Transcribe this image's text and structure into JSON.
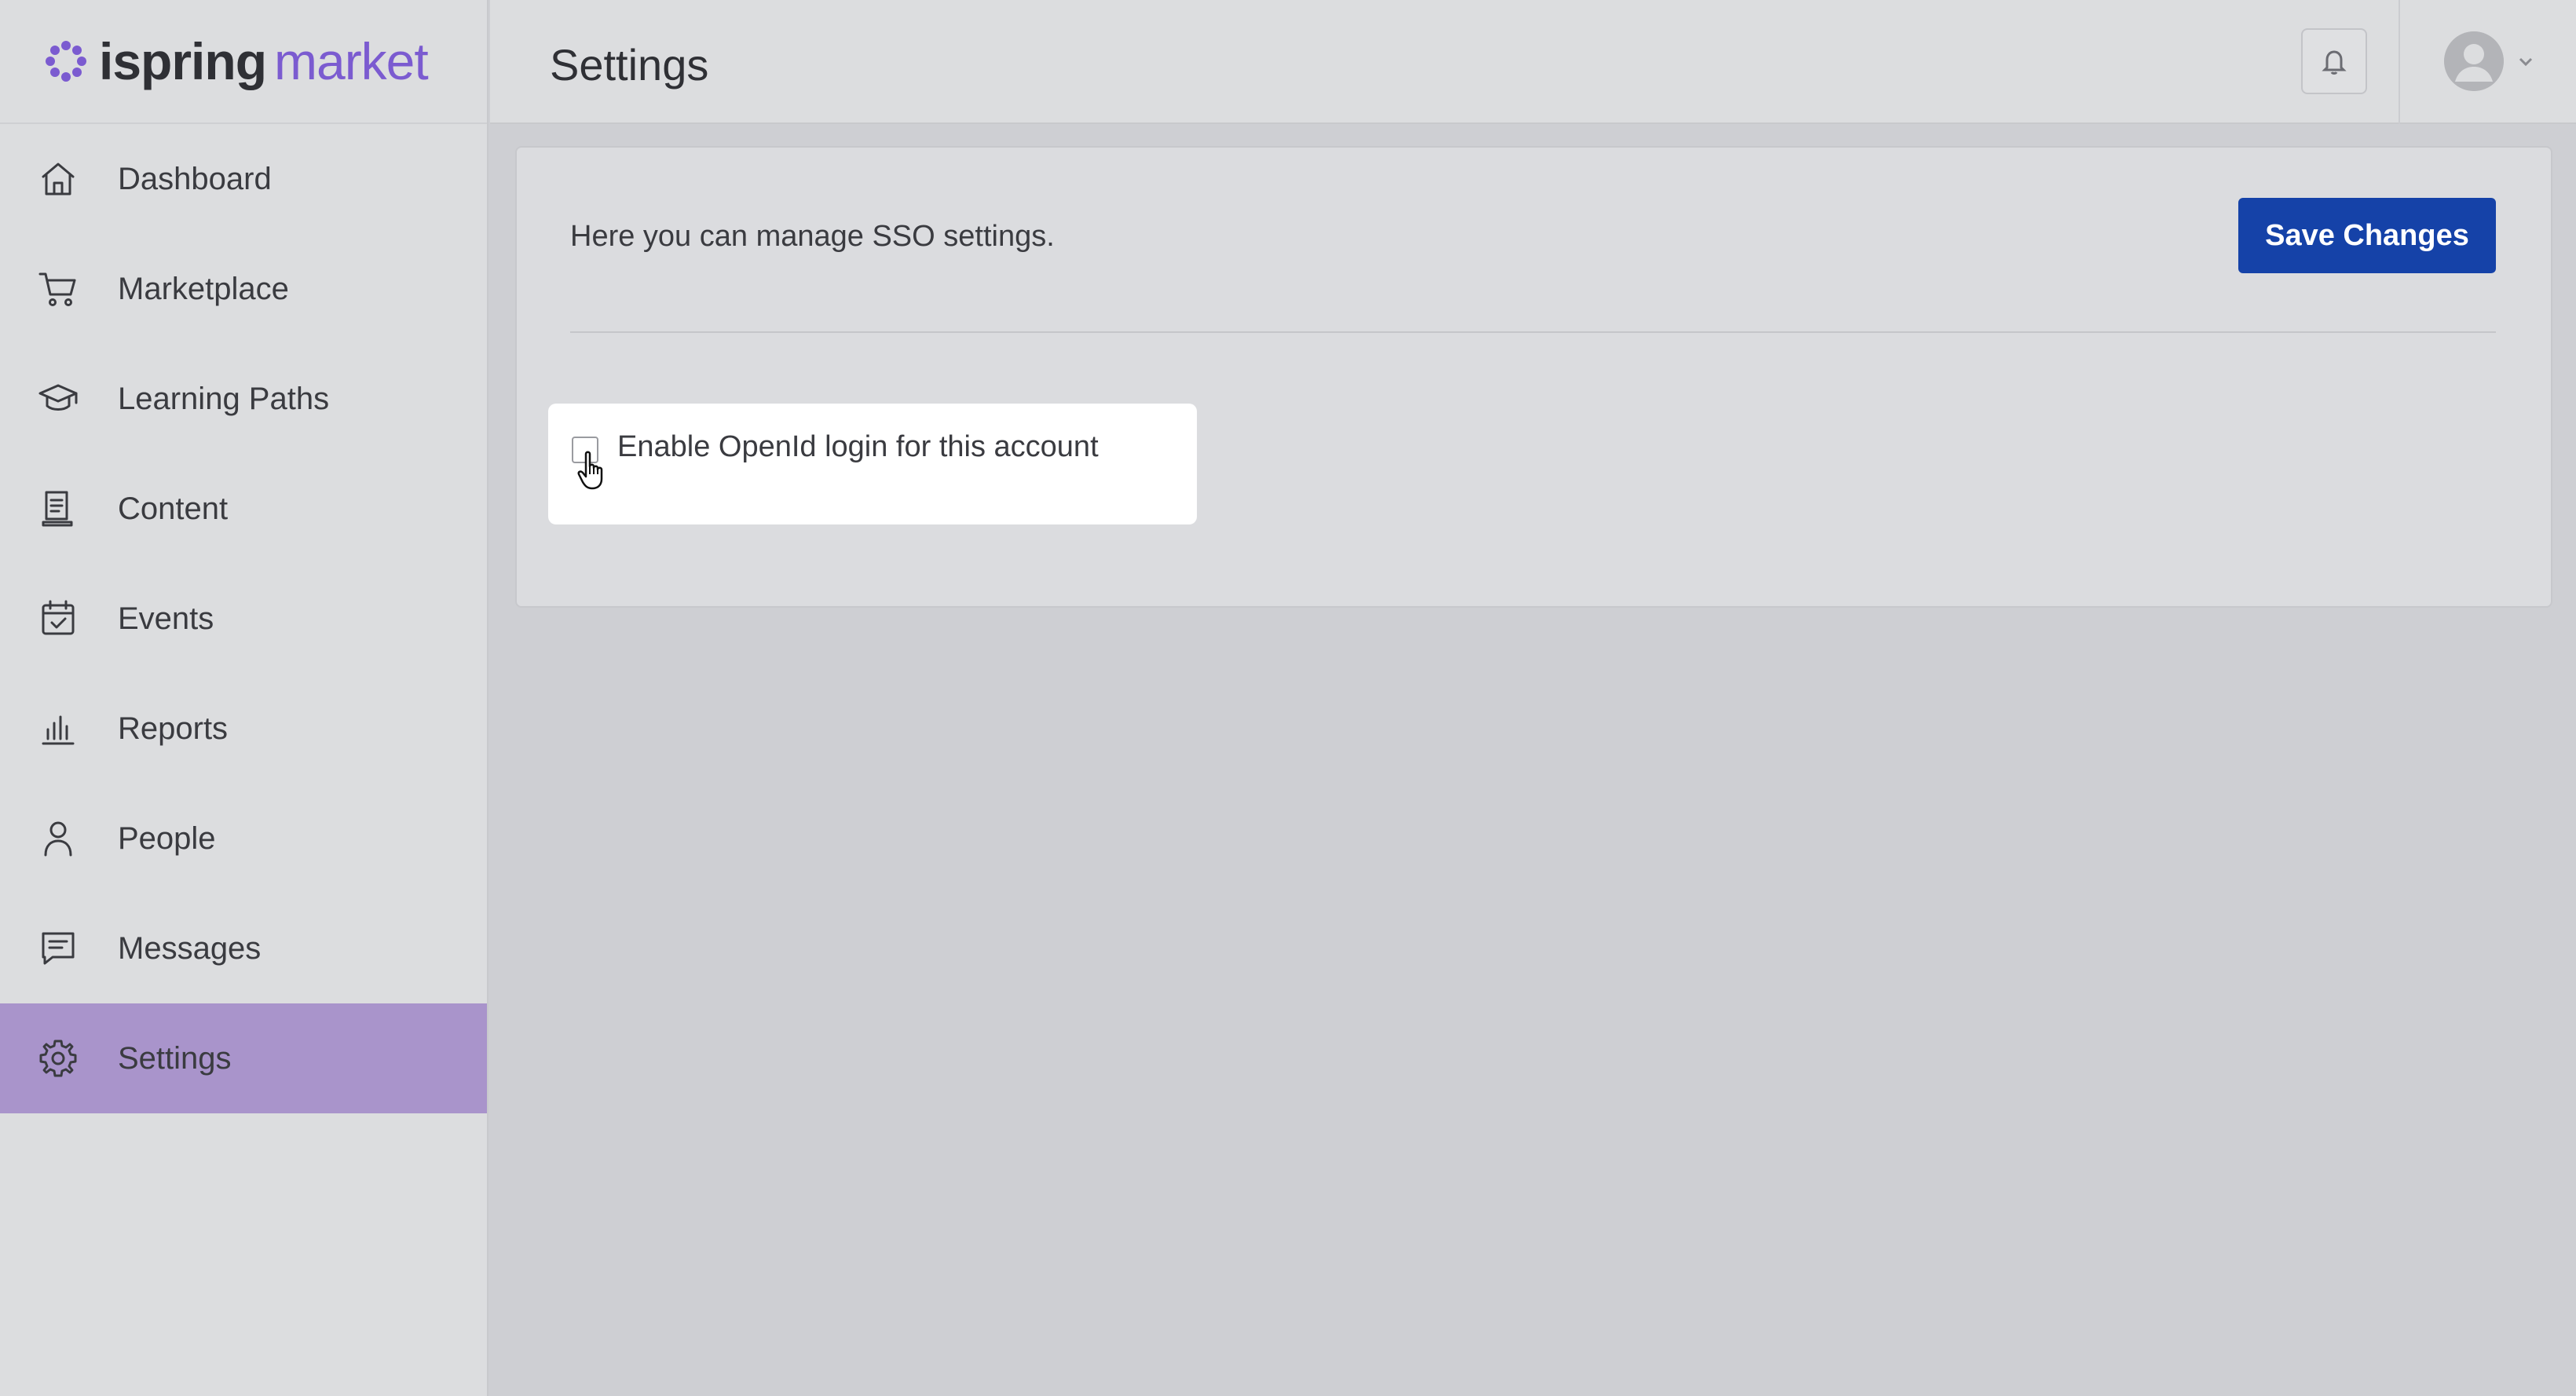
{
  "brand": {
    "name_part1": "ispring",
    "name_part2": "market",
    "accent_color": "#7b5bd0"
  },
  "sidebar": {
    "items": [
      {
        "label": "Dashboard",
        "icon": "home-icon",
        "active": false
      },
      {
        "label": "Marketplace",
        "icon": "cart-icon",
        "active": false
      },
      {
        "label": "Learning Paths",
        "icon": "graduation-cap-icon",
        "active": false
      },
      {
        "label": "Content",
        "icon": "document-icon",
        "active": false
      },
      {
        "label": "Events",
        "icon": "calendar-check-icon",
        "active": false
      },
      {
        "label": "Reports",
        "icon": "bar-chart-icon",
        "active": false
      },
      {
        "label": "People",
        "icon": "person-icon",
        "active": false
      },
      {
        "label": "Messages",
        "icon": "message-icon",
        "active": false
      },
      {
        "label": "Settings",
        "icon": "gear-icon",
        "active": true
      }
    ],
    "active_color": "#a994cb"
  },
  "header": {
    "title": "Settings",
    "notifications_icon": "bell-icon",
    "account_icon": "avatar-icon"
  },
  "main": {
    "description": "Here you can manage SSO settings.",
    "save_label": "Save Changes",
    "save_color": "#1542a8",
    "option": {
      "label": "Enable OpenId login for this account",
      "checked": false
    }
  }
}
